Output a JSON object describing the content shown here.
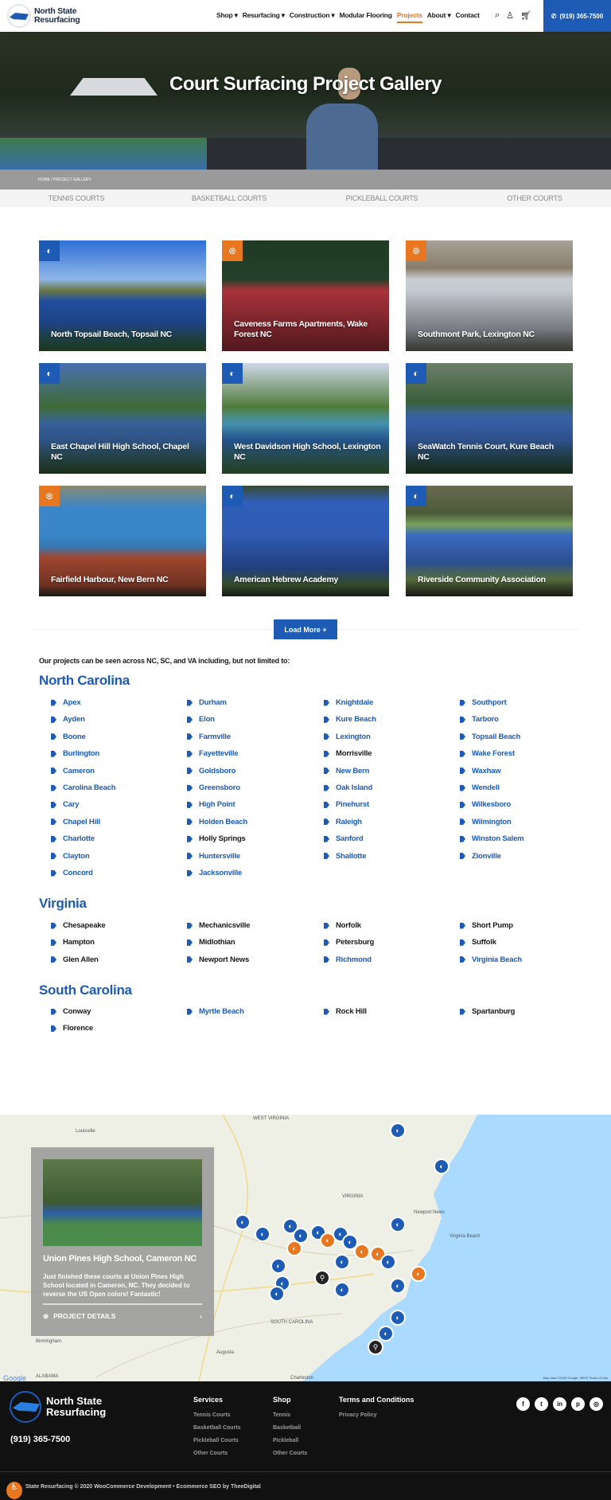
{
  "header": {
    "brand": [
      "North State",
      "Resurfacing"
    ],
    "nav": [
      {
        "label": "Shop ▾"
      },
      {
        "label": "Resurfacing ▾"
      },
      {
        "label": "Construction ▾"
      },
      {
        "label": "Modular Flooring"
      },
      {
        "label": "Projects",
        "active": true
      },
      {
        "label": "About ▾"
      },
      {
        "label": "Contact"
      }
    ],
    "phone": "(919) 365-7500",
    "icons": [
      "search-icon",
      "user-icon",
      "cart-icon"
    ]
  },
  "hero": {
    "title": "Court Surfacing Project Gallery"
  },
  "breadcrumb": "HOME / PROJECT GALLERY",
  "filter_tabs": [
    "TENNIS COURTS",
    "BASKETBALL COURTS",
    "PICKLEBALL COURTS",
    "OTHER COURTS"
  ],
  "gallery": [
    {
      "caption": "North Topsail Beach, Topsail NC",
      "type": "tennis"
    },
    {
      "caption": "Caveness Farms Apartments, Wake Forest NC",
      "type": "basketball"
    },
    {
      "caption": "Southmont Park, Lexington NC",
      "type": "basketball"
    },
    {
      "caption": "East Chapel Hill High School, Chapel NC",
      "type": "tennis"
    },
    {
      "caption": "West Davidson High School, Lexington NC",
      "type": "tennis"
    },
    {
      "caption": "SeaWatch Tennis Court, Kure Beach NC",
      "type": "tennis"
    },
    {
      "caption": "Fairfield Harbour, New Bern NC",
      "type": "basketball"
    },
    {
      "caption": "American Hebrew Academy",
      "type": "tennis"
    },
    {
      "caption": "Riverside Community Association",
      "type": "tennis"
    }
  ],
  "load_more": "Load More +",
  "intro": "Our projects can be seen across NC, SC, and VA including, but not limited to:",
  "states": [
    {
      "name": "North Carolina",
      "cities": [
        [
          "Apex",
          "Ayden",
          "Boone",
          "Burlington",
          "Cameron",
          "Carolina Beach",
          "Cary",
          "Chapel Hill",
          "Charlotte",
          "Clayton",
          "Concord"
        ],
        [
          "Durham",
          "Elon",
          "Farmville",
          "Fayetteville",
          "Goldsboro",
          "Greensboro",
          "High Point",
          "Holden Beach",
          "Holly Springs",
          "Huntersville",
          "Jacksonville"
        ],
        [
          "Knightdale",
          "Kure Beach",
          "Lexington",
          "Morrisville",
          "New Bern",
          "Oak Island",
          "Pinehurst",
          "Raleigh",
          "Sanford",
          "Shallotte"
        ],
        [
          "Southport",
          "Tarboro",
          "Topsail Beach",
          "Wake Forest",
          "Waxhaw",
          "Wendell",
          "Wilkesboro",
          "Wilmington",
          "Winston Salem",
          "Zionville"
        ]
      ],
      "unlinked": [
        "Morrisville",
        "Holly Springs"
      ]
    },
    {
      "name": "Virginia",
      "cities": [
        [
          "Chesapeake",
          "Hampton",
          "Glen Allen"
        ],
        [
          "Mechanicsville",
          "Midlothian",
          "Newport News"
        ],
        [
          "Norfolk",
          "Petersburg",
          "Richmond"
        ],
        [
          "Short Pump",
          "Suffolk",
          "Virginia Beach"
        ]
      ],
      "linked": [
        "Richmond",
        "Virginia Beach"
      ]
    },
    {
      "name": "South Carolina",
      "cities": [
        [
          "Conway",
          "Florence"
        ],
        [
          "Myrtle Beach"
        ],
        [
          "Rock Hill"
        ],
        [
          "Spartanburg"
        ]
      ],
      "linked": [
        "Myrtle Beach"
      ]
    }
  ],
  "map": {
    "labels": [
      "Louisville",
      "WEST VIRGINIA",
      "VIRGINIA",
      "Virginia Beach",
      "Newport News",
      "SOUTH CAROLINA",
      "ALABAMA",
      "Birmingham",
      "Charleston",
      "Augusta",
      "Google"
    ],
    "attribution": "Map data ©2020 Google, INEGI   Terms of Use",
    "card": {
      "title": "Union Pines High School, Cameron NC",
      "text": "Just finished these courts at Union Pines High School located in Cameron, NC. They decided to reverse the US Open colors! Fantastic!",
      "link": "PROJECT DETAILS"
    }
  },
  "footer": {
    "brand": [
      "North State",
      "Resurfacing"
    ],
    "phone": "(919) 365-7500",
    "columns": [
      {
        "title": "Services",
        "items": [
          "Tennis Courts",
          "Basketball Courts",
          "Pickleball Courts",
          "Other Courts"
        ]
      },
      {
        "title": "Shop",
        "items": [
          "Tennis",
          "Basketball",
          "Pickleball",
          "Other Courts"
        ]
      },
      {
        "title": "Terms and Conditions",
        "items": [
          "Privacy Policy"
        ]
      }
    ],
    "social": [
      "facebook-icon",
      "twitter-icon",
      "linkedin-icon",
      "pinterest-icon",
      "instagram-icon"
    ],
    "copyright": "State Resurfacing © 2020 WooCommerce Development • Ecommerce SEO by TheeDigital"
  },
  "colors": {
    "brand_blue": "#1d5bb5",
    "accent_orange": "#e87722",
    "footer_bg": "#111111"
  }
}
